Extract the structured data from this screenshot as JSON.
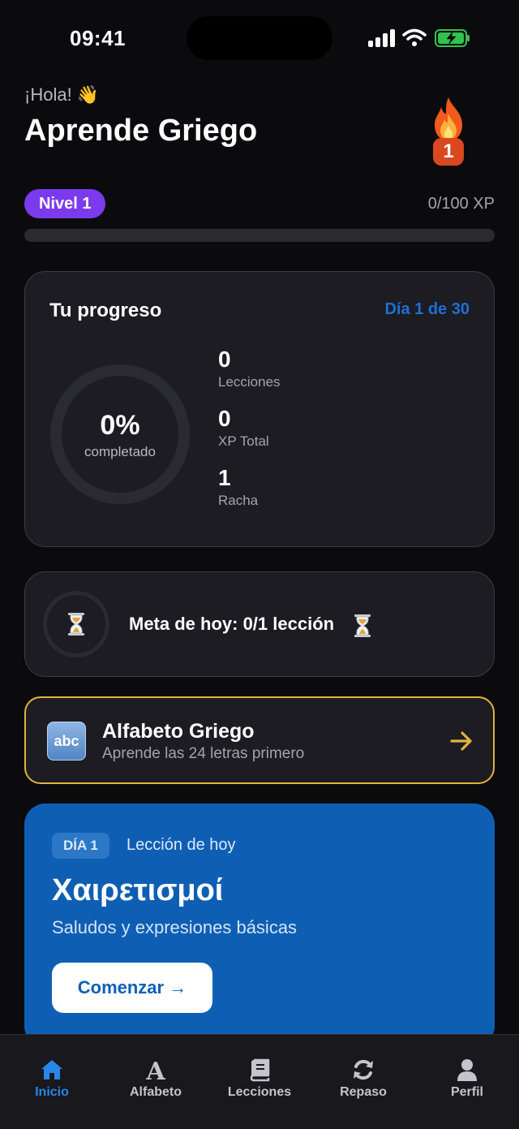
{
  "status_bar": {
    "time": "09:41"
  },
  "header": {
    "greeting": "¡Hola! 👋",
    "title": "Aprende Griego",
    "streak_count": "1"
  },
  "level": {
    "label": "Nivel 1",
    "xp_text": "0/100 XP",
    "xp_progress": 0
  },
  "progress_card": {
    "title": "Tu progreso",
    "day_counter": "Día 1 de 30",
    "percent": "0%",
    "percent_label": "completado",
    "stats": [
      {
        "value": "0",
        "label": "Lecciones"
      },
      {
        "value": "0",
        "label": "XP Total"
      },
      {
        "value": "1",
        "label": "Racha"
      }
    ]
  },
  "goal_card": {
    "text": "Meta de hoy: 0/1 lección"
  },
  "alphabet_card": {
    "icon_text": "abc",
    "title": "Alfabeto Griego",
    "subtitle": "Aprende las 24 letras primero"
  },
  "lesson_card": {
    "day_badge": "DÍA 1",
    "tag": "Lección de hoy",
    "title": "Χαιρετισμοί",
    "subtitle": "Saludos y expresiones básicas",
    "button": "Comenzar →"
  },
  "tab_bar": {
    "tabs": [
      {
        "label": "Inicio",
        "icon": "home-icon",
        "active": true
      },
      {
        "label": "Alfabeto",
        "icon": "alphabet-icon"
      },
      {
        "label": "Lecciones",
        "icon": "book-icon"
      },
      {
        "label": "Repaso",
        "icon": "refresh-icon"
      },
      {
        "label": "Perfil",
        "icon": "user-icon"
      }
    ]
  },
  "colors": {
    "background": "#0b0b0e",
    "accent_purple": "#7c3aed",
    "accent_blue": "#0e5fb4",
    "accent_gold": "#e0b43c",
    "streak_orange": "#d9481f"
  }
}
